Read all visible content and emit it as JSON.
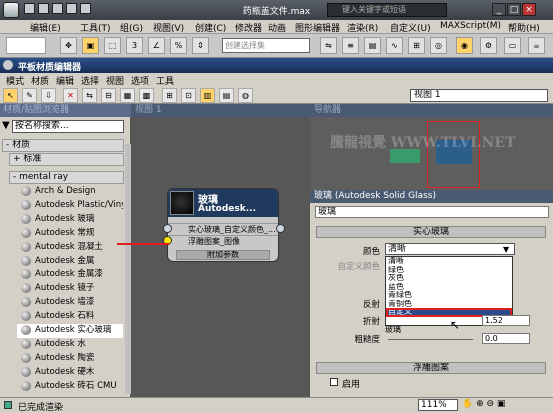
{
  "app": {
    "title": "药瓶盖文件.max",
    "search_placeholder": "键入关键字或短语",
    "min": "_",
    "max": "□",
    "close": "×"
  },
  "main_menu": [
    "编辑(E)",
    "工具(T)",
    "组(G)",
    "视图(V)",
    "创建(C)",
    "修改器",
    "动画",
    "图形编辑器",
    "渲染(R)",
    "自定义(U)",
    "MAXScript(M)",
    "帮助(H)"
  ],
  "toolbar": {
    "selection_set_placeholder": "创建选择集",
    "snap_labels": [
      "3",
      "%"
    ]
  },
  "editor": {
    "title": "平板材质编辑器",
    "menu": [
      "模式",
      "材质",
      "编辑",
      "选择",
      "视图",
      "选项",
      "工具"
    ],
    "view_select": "视图 1"
  },
  "browser": {
    "header": "材质/贴图浏览器",
    "search": "按名称搜索...",
    "cat_materials": "- 材质",
    "cat_standard": "+ 标准",
    "cat_mentalray": "- mental ray",
    "items": [
      "Arch & Design",
      "Autodesk Plastic/Vinyl",
      "Autodesk 玻璃",
      "Autodesk 常规",
      "Autodesk 混凝土",
      "Autodesk 金属",
      "Autodesk 金属漆",
      "Autodesk 镜子",
      "Autodesk 墙漆",
      "Autodesk 石料",
      "Autodesk 实心玻璃",
      "Autodesk 水",
      "Autodesk 陶瓷",
      "Autodesk 硬木",
      "Autodesk 砖石 CMU"
    ],
    "selected_index": 10
  },
  "view": {
    "header": "视图 1",
    "node_title": "玻璃",
    "node_sub": "Autodesk...",
    "slot1": "实心玻璃_自定义颜色_...",
    "slot2": "浮雕图案_图像",
    "extra": "附加参数"
  },
  "navigator": {
    "header": "导航器",
    "watermark": "騰龍視覺 WWW.TLVI.NET"
  },
  "params": {
    "header": "玻璃 (Autodesk Solid Glass)",
    "name_value": "玻璃",
    "rollout1": "实心玻璃",
    "color_label": "颜色",
    "custom_color_label": "自定义颜色",
    "color_selected": "清晰",
    "color_options": [
      "清晰",
      "绿色",
      "灰色",
      "蓝色",
      "青绿色",
      "青铜色",
      "自定义"
    ],
    "color_highlight_index": 6,
    "reflect_label": "反射",
    "refract_label": "折射",
    "refract_value": "1.52",
    "refract_sub": "玻璃",
    "rough_label": "粗糙度",
    "rough_value": "0.0",
    "rollout2": "浮雕图案",
    "enable_label": "启用"
  },
  "status": {
    "text": "已完成渲染",
    "zoom": "111%"
  }
}
